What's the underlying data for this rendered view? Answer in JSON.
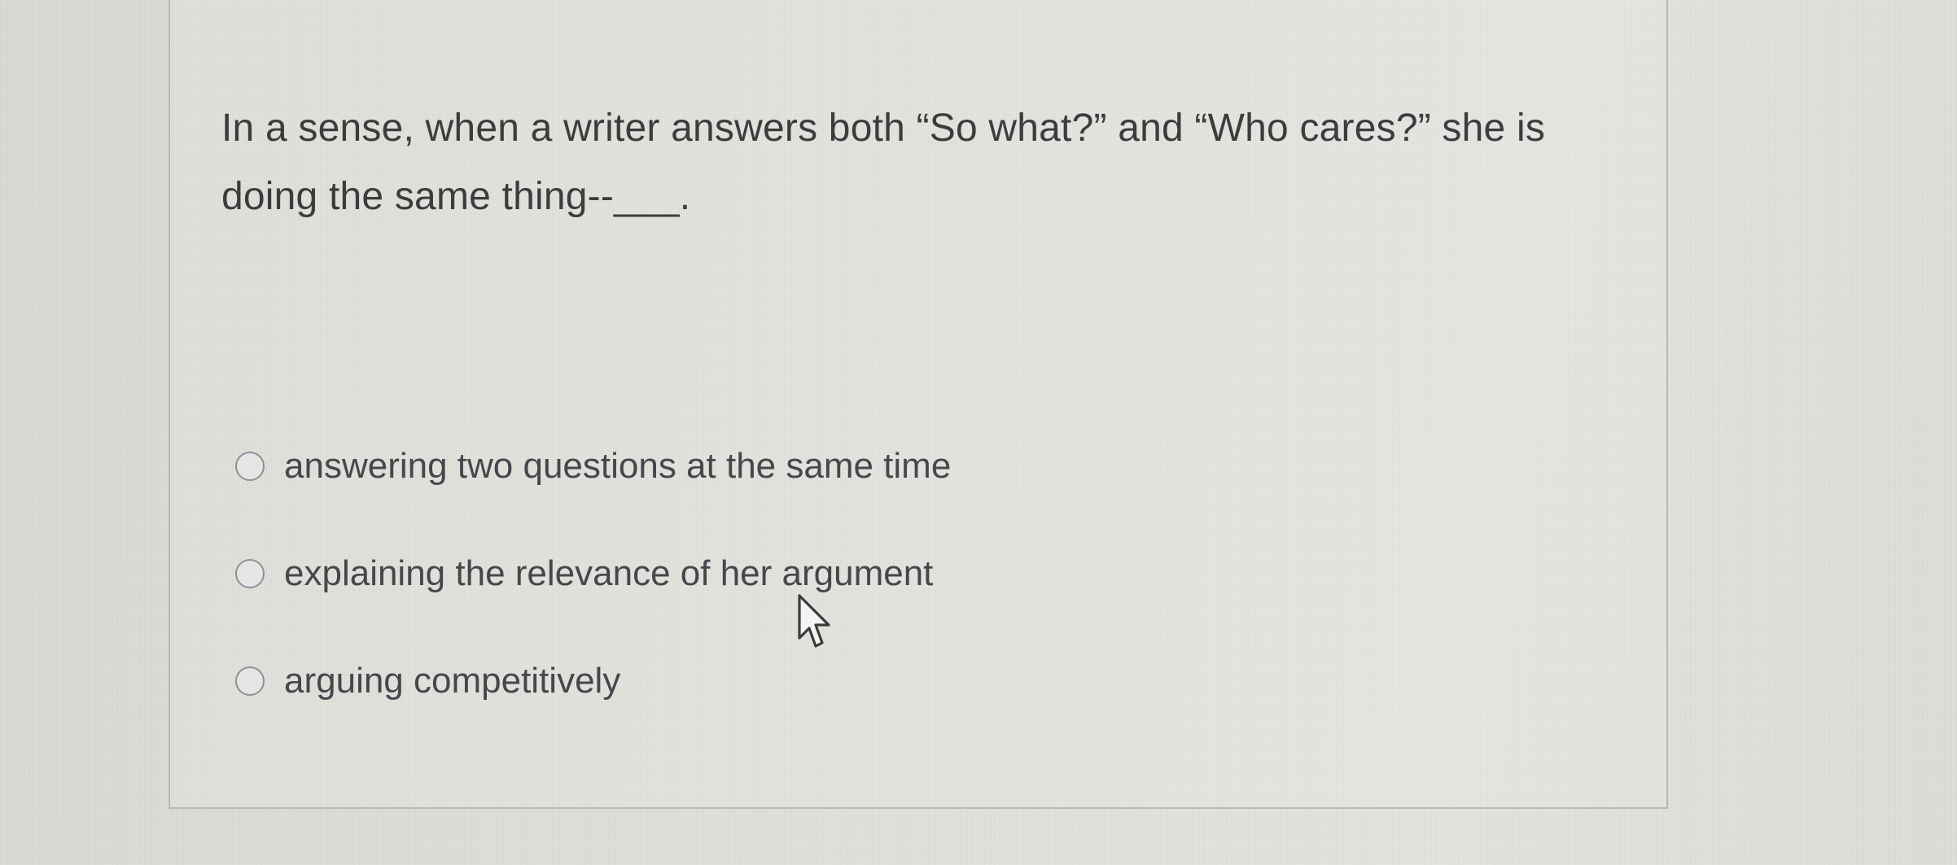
{
  "question": {
    "text": "In a sense, when a writer answers both “So what?” and “Who cares?” she is doing the same thing--___."
  },
  "answers": [
    {
      "label": "answering two questions at the same time",
      "selected": false
    },
    {
      "label": "explaining the relevance of her argument",
      "selected": false
    },
    {
      "label": "arguing competitively",
      "selected": false
    }
  ],
  "icons": {
    "radio": "radio-unchecked-icon",
    "cursor": "mouse-pointer-icon"
  }
}
